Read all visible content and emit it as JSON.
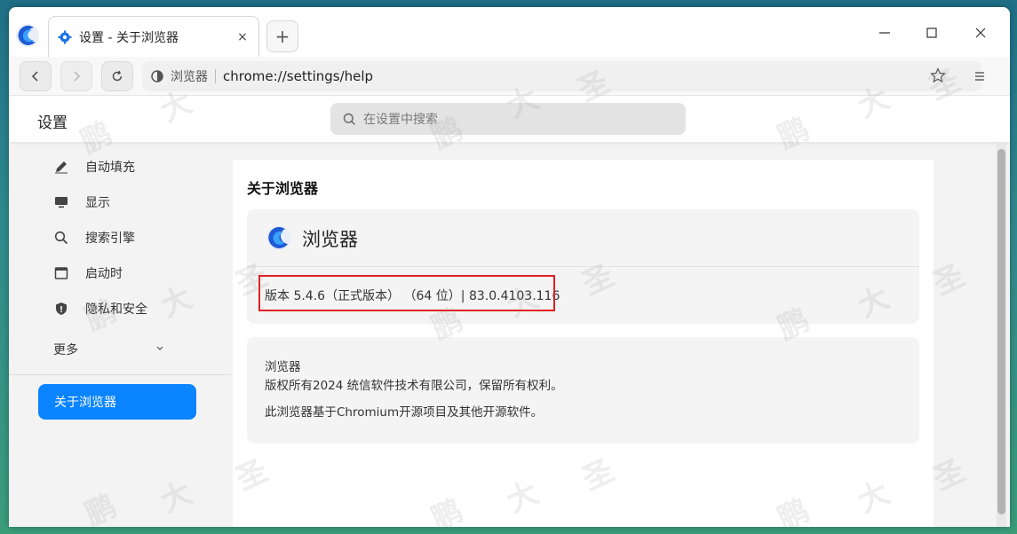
{
  "window": {
    "tab_title": "设置 - 关于浏览器",
    "tab_close": "×",
    "new_tab": "+"
  },
  "toolbar": {
    "site_label": "浏览器",
    "url": "chrome://settings/help"
  },
  "settings": {
    "title": "设置",
    "search_placeholder": "在设置中搜索"
  },
  "sidebar": {
    "items": [
      {
        "label": "自动填充",
        "icon": "pencil-icon"
      },
      {
        "label": "显示",
        "icon": "monitor-icon"
      },
      {
        "label": "搜索引擎",
        "icon": "search-icon"
      },
      {
        "label": "启动时",
        "icon": "window-icon"
      },
      {
        "label": "隐私和安全",
        "icon": "shield-icon"
      }
    ],
    "more_label": "更多",
    "active_label": "关于浏览器"
  },
  "main": {
    "heading": "关于浏览器",
    "brand_name": "浏览器",
    "version": "版本 5.4.6（正式版本） （64 位）| 83.0.4103.116",
    "about_lines": [
      "浏览器",
      "版权所有2024 统信软件技术有限公司，保留所有权利。",
      "此浏览器基于Chromium开源项目及其他开源软件。"
    ]
  },
  "watermark": {
    "chars": [
      "鹏",
      "大",
      "圣"
    ]
  },
  "colors": {
    "accent": "#0a84ff",
    "highlight": "#e02020"
  }
}
